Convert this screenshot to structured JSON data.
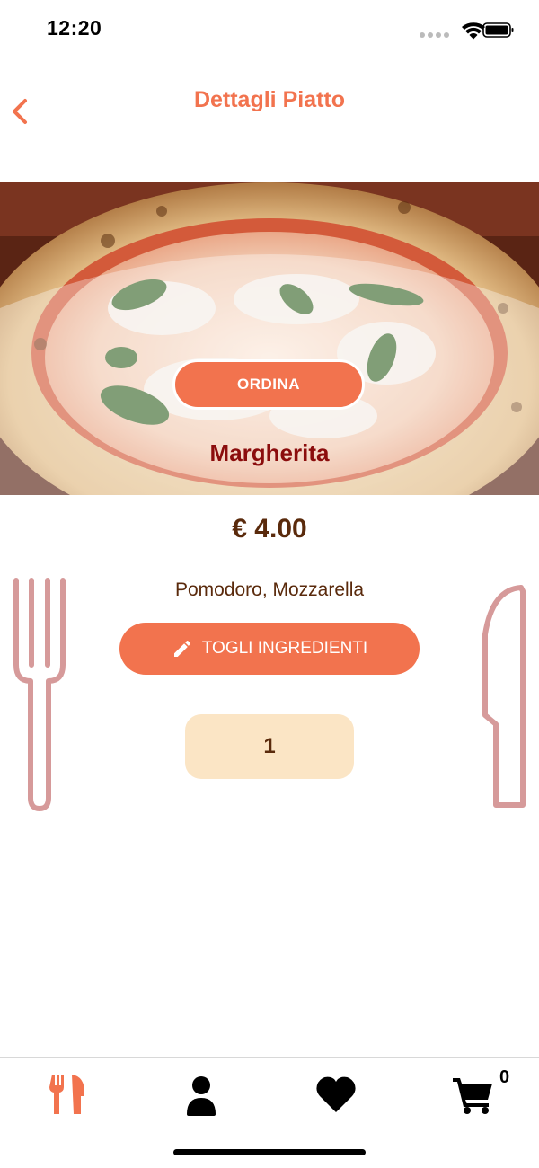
{
  "status_bar": {
    "time": "12:20"
  },
  "nav": {
    "title": "Dettagli Piatto",
    "back_icon": "chevron-left-icon"
  },
  "dish": {
    "order_label": "ORDINA",
    "name": "Margherita",
    "price": "€ 4.00",
    "ingredients": "Pomodoro, Mozzarella",
    "remove_label": "TOGLI INGREDIENTI",
    "quantity": "1"
  },
  "tab_bar": {
    "tabs": [
      {
        "name": "menu",
        "icon": "fork-knife-icon",
        "active": true
      },
      {
        "name": "profile",
        "icon": "user-icon",
        "active": false
      },
      {
        "name": "favorites",
        "icon": "heart-icon",
        "active": false
      },
      {
        "name": "cart",
        "icon": "cart-icon",
        "active": false
      }
    ],
    "cart_count": "0"
  },
  "colors": {
    "accent": "#F2734E",
    "dish_name": "#8B0D0D",
    "text_brown": "#5A2A0C",
    "quantity_bg": "#FBE5C5",
    "cutlery": "#D69A9A"
  }
}
